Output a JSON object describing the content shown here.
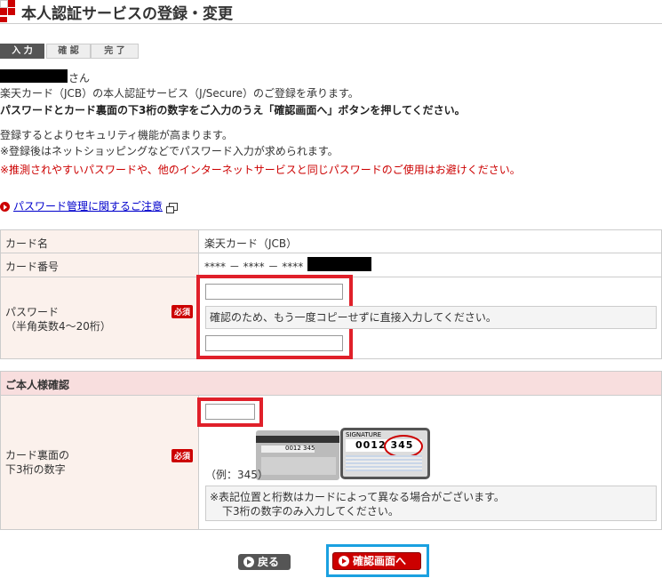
{
  "header": {
    "title": "本人認証サービスの登録・変更"
  },
  "steps": [
    {
      "label": "入 力",
      "active": true
    },
    {
      "label": "確 認",
      "active": false
    },
    {
      "label": "完 了",
      "active": false
    }
  ],
  "intro": {
    "salutation": "さん",
    "line1": "楽天カード（JCB）の本人認証サービス（J/Secure）のご登録を承ります。",
    "line2": "パスワードとカード裏面の下3桁の数字をご入力のうえ「確認画面へ」ボタンを押してください。",
    "line3": "登録するとよりセキュリティ機能が高まります。",
    "line4": "※登録後はネットショッピングなどでパスワード入力が求められます。",
    "line5": "※推測されやすいパスワードや、他のインターネットサービスと同じパスワードのご使用はお避けください。"
  },
  "password_note_link": "パスワード管理に関するご注意",
  "form": {
    "card_name_label": "カード名",
    "card_name_value": "楽天カード（JCB）",
    "card_number_label": "カード番号",
    "card_number_value": "**** － **** － **** －",
    "password_label": "パスワード",
    "password_sub": "（半角英数4〜20桁）",
    "required": "必須",
    "password_value": "",
    "password_confirm_value": "",
    "confirm_note": "確認のため、もう一度コピーせずに直接入力してください。"
  },
  "identity": {
    "section_title": "ご本人様確認",
    "cvv_label_1": "カード裏面の",
    "cvv_label_2": "下3桁の数字",
    "required": "必須",
    "cvv_value": "",
    "signature_label": "SIGNATURE",
    "card_number_sample": "0012 345",
    "example": "（例：345）",
    "note_line1": "※表記位置と桁数はカードによって異なる場合がございます。",
    "note_line2": "下3桁の数字のみ入力してください。"
  },
  "buttons": {
    "back": "戻る",
    "confirm": "確認画面へ"
  },
  "colors": {
    "accent": "#cc0000",
    "highlight_red": "#e0202a",
    "highlight_blue": "#1aa0e0"
  }
}
